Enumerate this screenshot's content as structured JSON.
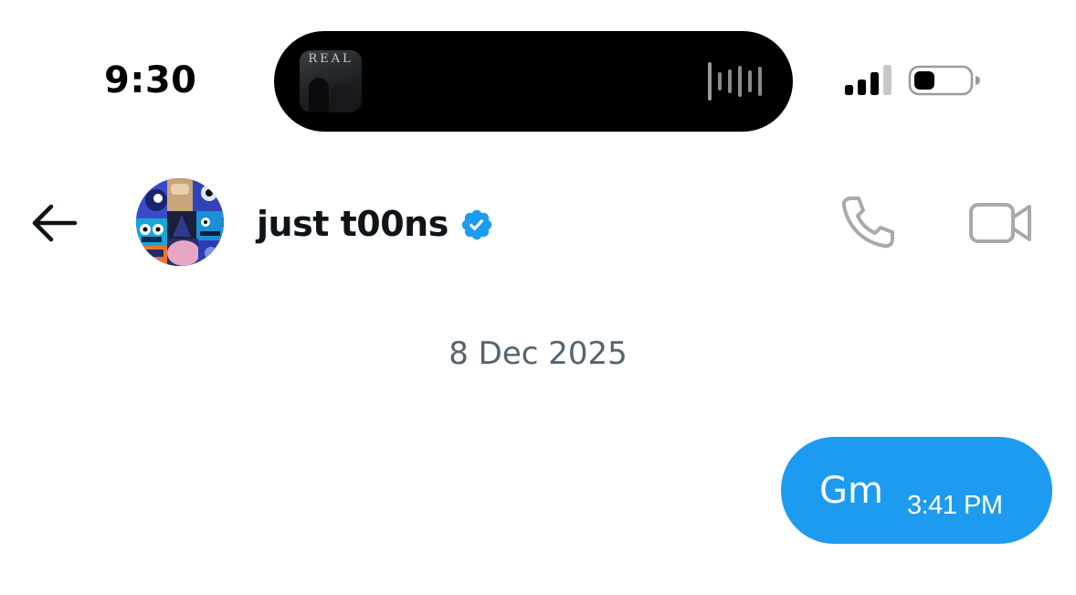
{
  "status_bar": {
    "time": "9:30",
    "now_playing": {
      "album_art_label": "REAL",
      "waveform_icon": "audio-waveform-icon"
    },
    "signal_icon": "cellular-signal-icon",
    "battery_icon": "battery-icon"
  },
  "header": {
    "back_icon": "arrow-left-icon",
    "contact_name": "just t00ns",
    "verified_icon": "verified-badge-icon",
    "call_icon": "phone-icon",
    "video_icon": "video-camera-icon"
  },
  "conversation": {
    "date_separator": "8 Dec 2025",
    "messages": [
      {
        "direction": "outgoing",
        "text": "Gm",
        "time": "3:41 PM"
      }
    ]
  },
  "colors": {
    "accent": "#1d9bf0",
    "text_primary": "#0f1419",
    "text_secondary": "#536471",
    "icon_muted": "#a6aaad",
    "background": "#ffffff"
  }
}
